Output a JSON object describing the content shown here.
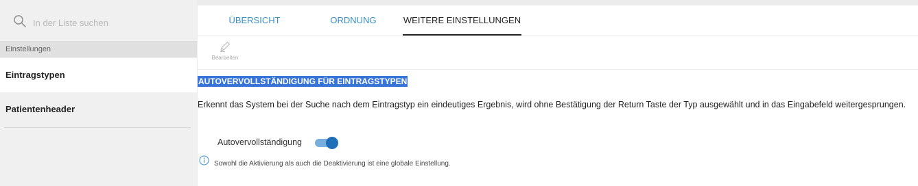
{
  "search": {
    "placeholder": "In der Liste suchen"
  },
  "sidebar": {
    "section_label": "Einstellungen",
    "items": [
      {
        "label": "Eintragstypen",
        "active": true
      },
      {
        "label": "Patientenheader",
        "active": false
      }
    ]
  },
  "tabs": [
    {
      "label": "ÜBERSICHT",
      "active": false
    },
    {
      "label": "ORDNUNG",
      "active": false
    },
    {
      "label": "WEITERE EINSTELLUNGEN",
      "active": true
    }
  ],
  "toolbar": {
    "edit_label": "Bearbeiten"
  },
  "content": {
    "section_title": "AUTOVERVOLLSTÄNDIGUNG FÜR EINTRAGSTYPEN",
    "description": "Erkennt das System bei der Suche nach dem Eintragstyp ein eindeutiges Ergebnis, wird ohne Bestätigung der Return Taste der Typ ausgewählt und in das Eingabefeld weitergesprungen.",
    "setting": {
      "label": "Autovervollständigung",
      "enabled": true
    },
    "hint": "Sowohl die Aktivierung als auch die Deaktivierung ist eine globale Einstellung."
  },
  "colors": {
    "accent": "#3b8fc7",
    "toggle_on": "#1f6fb8",
    "selection": "#3875d7"
  },
  "icons": [
    "search-icon",
    "pencil-icon",
    "info-icon"
  ]
}
